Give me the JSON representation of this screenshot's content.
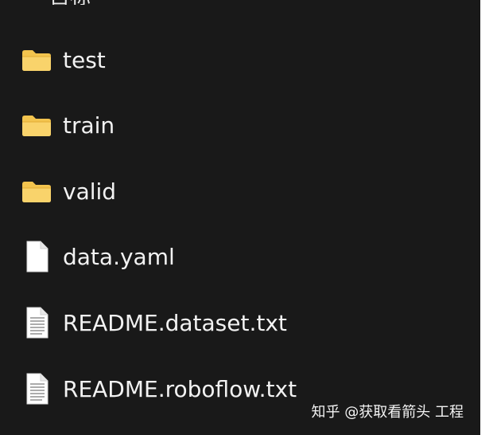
{
  "window": {
    "partial_header": "目标"
  },
  "file_list": {
    "items": [
      {
        "name": "test",
        "type": "folder",
        "icon": "folder-icon"
      },
      {
        "name": "train",
        "type": "folder",
        "icon": "folder-icon"
      },
      {
        "name": "valid",
        "type": "folder",
        "icon": "folder-icon"
      },
      {
        "name": "data.yaml",
        "type": "file",
        "icon": "blank-document-icon"
      },
      {
        "name": "README.dataset.txt",
        "type": "file",
        "icon": "text-document-icon"
      },
      {
        "name": "README.roboflow.txt",
        "type": "file",
        "icon": "text-document-icon"
      }
    ]
  },
  "watermark": {
    "text": "知乎 @获取看箭头 工程"
  },
  "colors": {
    "background": "#191919",
    "text": "#f2f2f2",
    "folder": "#f7c94e",
    "folder_dark": "#e7b33a",
    "document": "#ffffff"
  }
}
